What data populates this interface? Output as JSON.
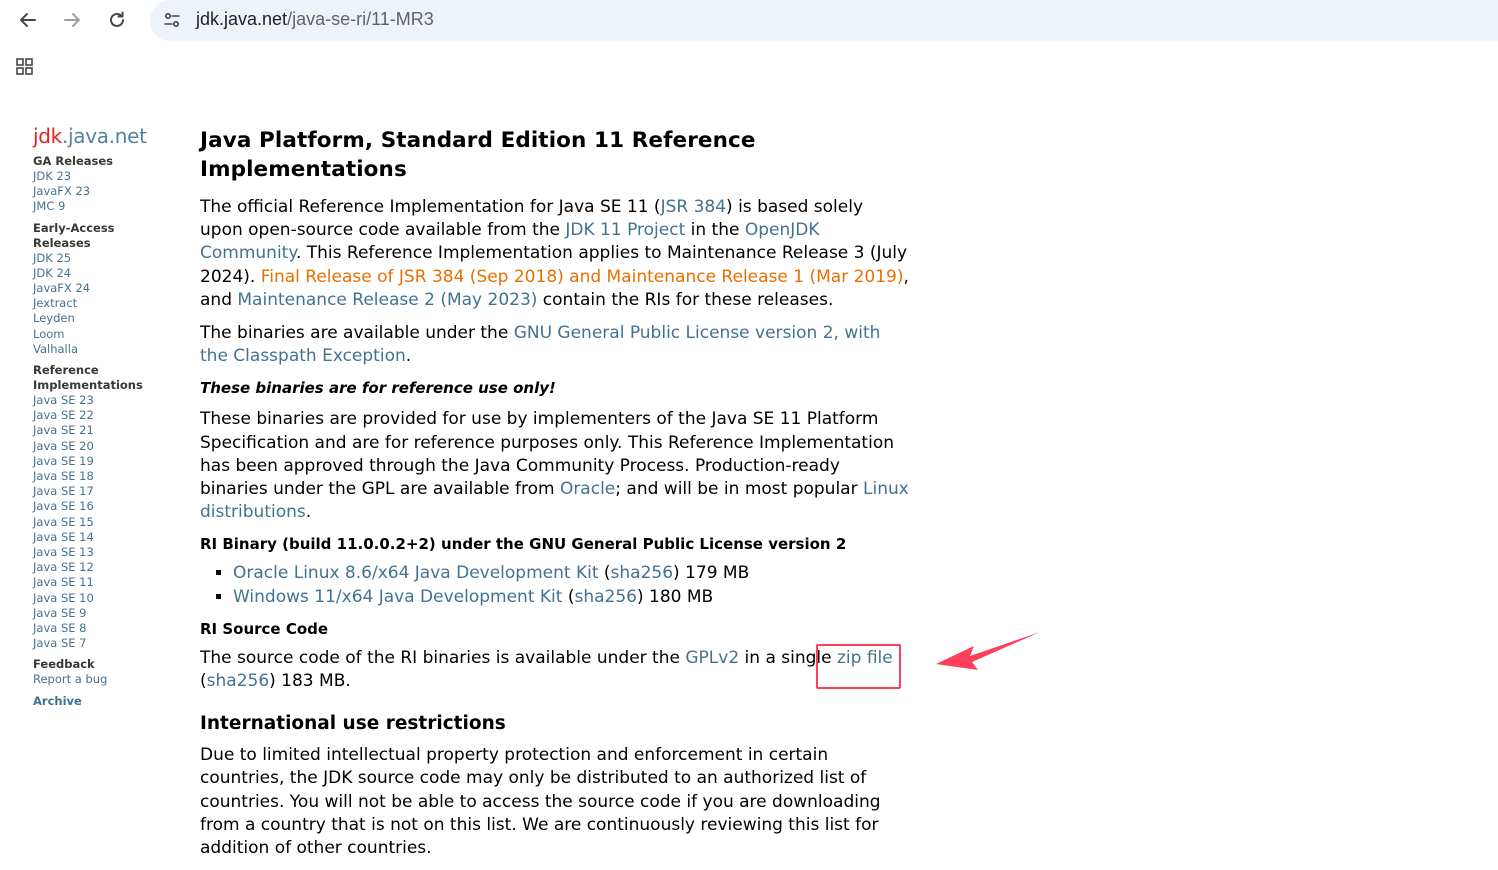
{
  "browser": {
    "url_host": "jdk.java.net",
    "url_path": "/java-se-ri/11-MR3"
  },
  "colors": {
    "link": "#437291",
    "orange": "#e76f00",
    "logo_red": "#e2231a",
    "annotation": "#ff3e5c"
  },
  "sidebar": {
    "logo_jdk": "jdk",
    "logo_rest": ".java.net",
    "ga_heading": "GA Releases",
    "ga_items": [
      "JDK 23",
      "JavaFX 23",
      "JMC 9"
    ],
    "ea_heading_1": "Early-Access",
    "ea_heading_2": "Releases",
    "ea_items": [
      "JDK 25",
      "JDK 24",
      "JavaFX 24",
      "Jextract",
      "Leyden",
      "Loom",
      "Valhalla"
    ],
    "ri_heading_1": "Reference",
    "ri_heading_2": "Implementations",
    "ri_items": [
      "Java SE 23",
      "Java SE 22",
      "Java SE 21",
      "Java SE 20",
      "Java SE 19",
      "Java SE 18",
      "Java SE 17",
      "Java SE 16",
      "Java SE 15",
      "Java SE 14",
      "Java SE 13",
      "Java SE 12",
      "Java SE 11",
      "Java SE 10",
      "Java SE 9",
      "Java SE 8",
      "Java SE 7"
    ],
    "feedback_heading": "Feedback",
    "report_bug": "Report a bug",
    "archive": "Archive"
  },
  "main": {
    "title": "Java Platform, Standard Edition 11 Reference Implementations",
    "intro": {
      "t1": "The official Reference Implementation for Java SE 11 (",
      "jsr": "JSR 384",
      "t2": ") is based solely upon open-source code available from the ",
      "jdk_project": "JDK 11 Project",
      "t3": " in the ",
      "openjdk": "OpenJDK Community",
      "t4": ". This Reference Implementation applies to Maintenance Release 3 (July 2024). ",
      "final_link": "Final Release of JSR 384 (Sep 2018) and Maintenance Release 1 (Mar 2019)",
      "t5": ", and ",
      "mr2_link": "Maintenance Release 2 (May 2023)",
      "t6": " contain the RIs for these releases."
    },
    "license": {
      "t1": "The binaries are available under the ",
      "link": "GNU General Public License version 2, with the Classpath Exception",
      "t2": "."
    },
    "reference_only": "These binaries are for reference use only!",
    "provided": {
      "t1": "These binaries are provided for use by implementers of the Java SE 11 Platform Specification and are for reference purposes only. This Reference Implementation has been approved through the Java Community Process. Production-ready binaries under the GPL are available from ",
      "oracle": "Oracle",
      "t2": "; and will be in most popular ",
      "linux": "Linux distributions",
      "t3": "."
    },
    "binary_heading": "RI Binary (build 11.0.0.2+2) under the GNU General Public License version 2",
    "downloads": [
      {
        "name": "Oracle Linux 8.6/x64 Java Development Kit",
        "open": " (",
        "sha": "sha256",
        "size": ") 179 MB"
      },
      {
        "name": "Windows 11/x64 Java Development Kit",
        "open": " (",
        "sha": "sha256",
        "size": ") 180 MB"
      }
    ],
    "source_heading": "RI Source Code",
    "source": {
      "t1": "The source code of the RI binaries is available under the ",
      "gplv2": "GPLv2",
      "t2": " in a single ",
      "zip": "zip file",
      "t3": " (",
      "sha": "sha256",
      "t4": ") 183 MB."
    },
    "intl_heading": "International use restrictions",
    "intl_text": "Due to limited intellectual property protection and enforcement in certain countries, the JDK source code may only be distributed to an authorized list of countries. You will not be able to access the source code if you are downloading from a country that is not on this list. We are continuously reviewing this list for addition of other countries."
  }
}
